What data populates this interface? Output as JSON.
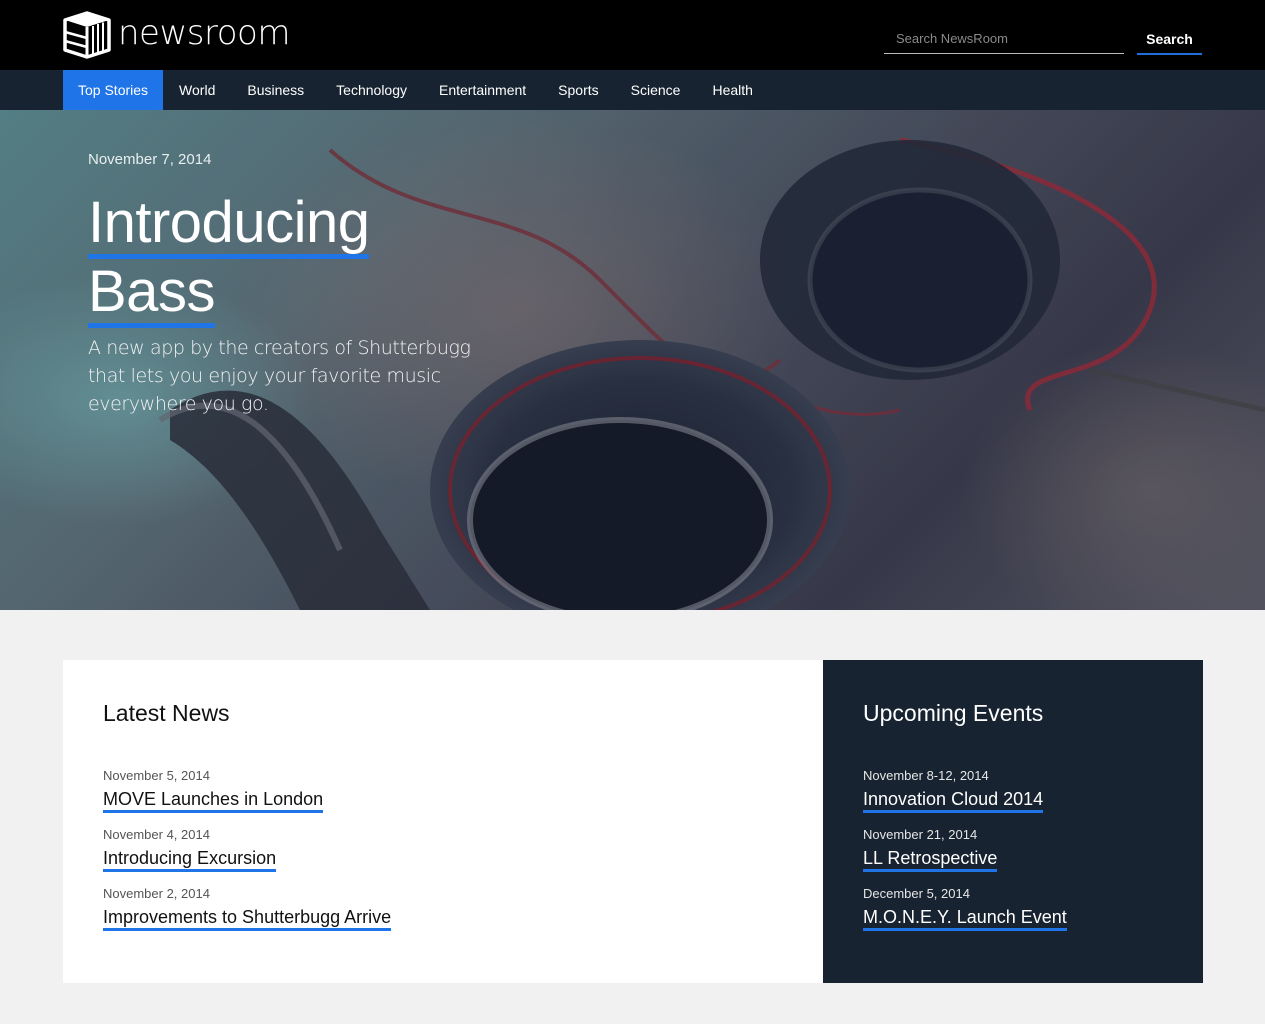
{
  "brand": {
    "name": "newsroom"
  },
  "search": {
    "placeholder": "Search NewsRoom",
    "button_label": "Search"
  },
  "nav": {
    "items": [
      {
        "label": "Top Stories",
        "active": true
      },
      {
        "label": "World"
      },
      {
        "label": "Business"
      },
      {
        "label": "Technology"
      },
      {
        "label": "Entertainment"
      },
      {
        "label": "Sports"
      },
      {
        "label": "Science"
      },
      {
        "label": "Health"
      }
    ]
  },
  "hero": {
    "date": "November 7, 2014",
    "title_line1": "Introducing",
    "title_line2": "Bass",
    "subtitle": "A new app by the creators of Shutterbugg that lets you enjoy your favorite music everywhere you go."
  },
  "latest_news": {
    "title": "Latest News",
    "items": [
      {
        "date": "November 5, 2014",
        "headline": "MOVE Launches in London"
      },
      {
        "date": "November 4, 2014",
        "headline": "Introducing Excursion"
      },
      {
        "date": "November 2, 2014",
        "headline": "Improvements to Shutterbugg Arrive"
      }
    ]
  },
  "events": {
    "title": "Upcoming Events",
    "items": [
      {
        "date": "November 8-12, 2014",
        "name": "Innovation Cloud 2014"
      },
      {
        "date": "November 21, 2014",
        "name": "LL Retrospective"
      },
      {
        "date": "December 5, 2014",
        "name": "M.O.N.E.Y. Launch Event"
      }
    ]
  },
  "colors": {
    "accent": "#1f74e8",
    "header_bg": "#000000",
    "nav_bg": "#172330",
    "page_bg": "#f1f1f1"
  }
}
